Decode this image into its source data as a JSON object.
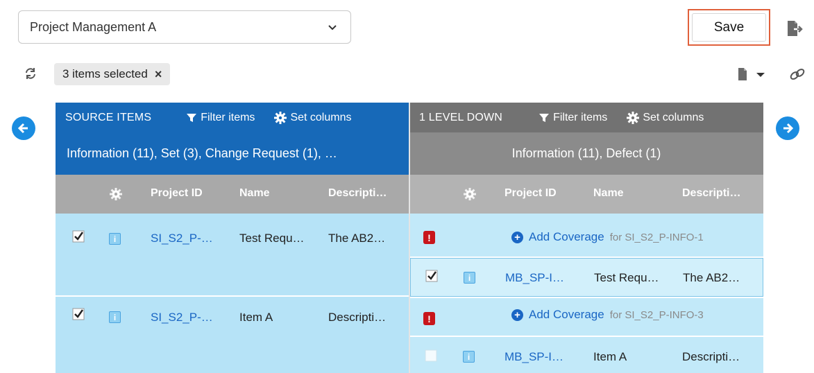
{
  "toolbar": {
    "project_select_value": "Project Management A",
    "save_label": "Save",
    "selection_text": "3 items selected",
    "selection_clear": "×"
  },
  "source_panel": {
    "title": "SOURCE ITEMS",
    "filter_label": "Filter items",
    "columns_label": "Set columns",
    "summary": "Information (11), Set (3), Change Request (1), …",
    "columns": [
      "Project ID",
      "Name",
      "Descripti…"
    ],
    "rows": [
      {
        "project_id": "SI_S2_P-…",
        "name": "Test Requ…",
        "description": "The AB2…",
        "checked": true
      },
      {
        "project_id": "SI_S2_P-…",
        "name": "Item A",
        "description": "Descripti…",
        "checked": true
      }
    ]
  },
  "target_panel": {
    "title": "1 LEVEL DOWN",
    "filter_label": "Filter items",
    "columns_label": "Set columns",
    "summary": "Information (11), Defect (1)",
    "columns": [
      "Project ID",
      "Name",
      "Descripti…"
    ],
    "groups": [
      {
        "add_label": "Add Coverage",
        "for_text": "for SI_S2_P-INFO-1",
        "row": {
          "project_id": "MB_SP-I…",
          "name": "Test Requ…",
          "description": "The AB2…",
          "checked": true
        }
      },
      {
        "add_label": "Add Coverage",
        "for_text": "for SI_S2_P-INFO-3",
        "row": {
          "project_id": "MB_SP-I…",
          "name": "Item A",
          "description": "Descripti…",
          "checked": false
        }
      }
    ]
  },
  "colors": {
    "source_header": "#1769b8",
    "target_header": "#727272",
    "save_highlight": "#e0603b",
    "link": "#1a66c4",
    "warning": "#c8151b"
  },
  "icons": [
    "chevron-down-icon",
    "export-icon",
    "refresh-icon",
    "document-icon",
    "link-icon",
    "filter-icon",
    "gear-icon",
    "arrow-left-icon",
    "arrow-right-icon",
    "info-icon",
    "warning-icon",
    "plus-circle-icon",
    "checkbox-icon"
  ]
}
